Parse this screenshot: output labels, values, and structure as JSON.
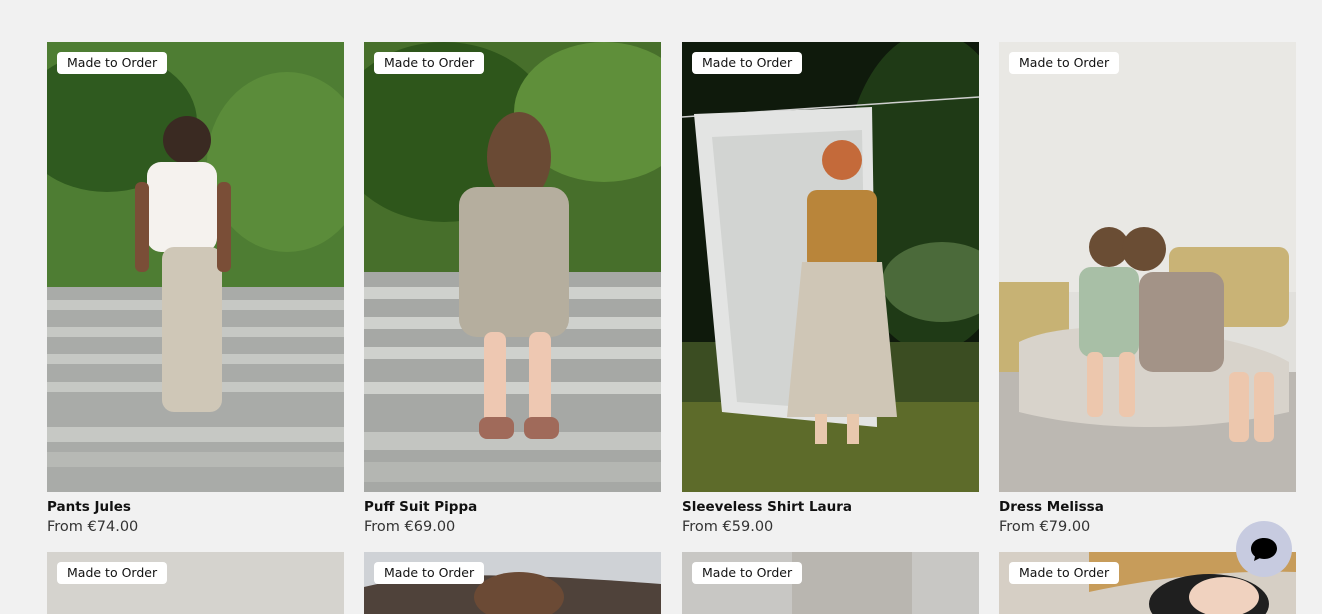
{
  "products": [
    {
      "badge": "Made to Order",
      "name": "Pants Jules",
      "price": "From €74.00"
    },
    {
      "badge": "Made to Order",
      "name": "Puff Suit Pippa",
      "price": "From €69.00"
    },
    {
      "badge": "Made to Order",
      "name": "Sleeveless Shirt Laura",
      "price": "From €59.00"
    },
    {
      "badge": "Made to Order",
      "name": "Dress Melissa",
      "price": "From €79.00"
    }
  ],
  "next_row": [
    {
      "badge": "Made to Order"
    },
    {
      "badge": "Made to Order"
    },
    {
      "badge": "Made to Order"
    },
    {
      "badge": "Made to Order"
    }
  ],
  "chat": {
    "icon": "chat-bubble-icon"
  }
}
